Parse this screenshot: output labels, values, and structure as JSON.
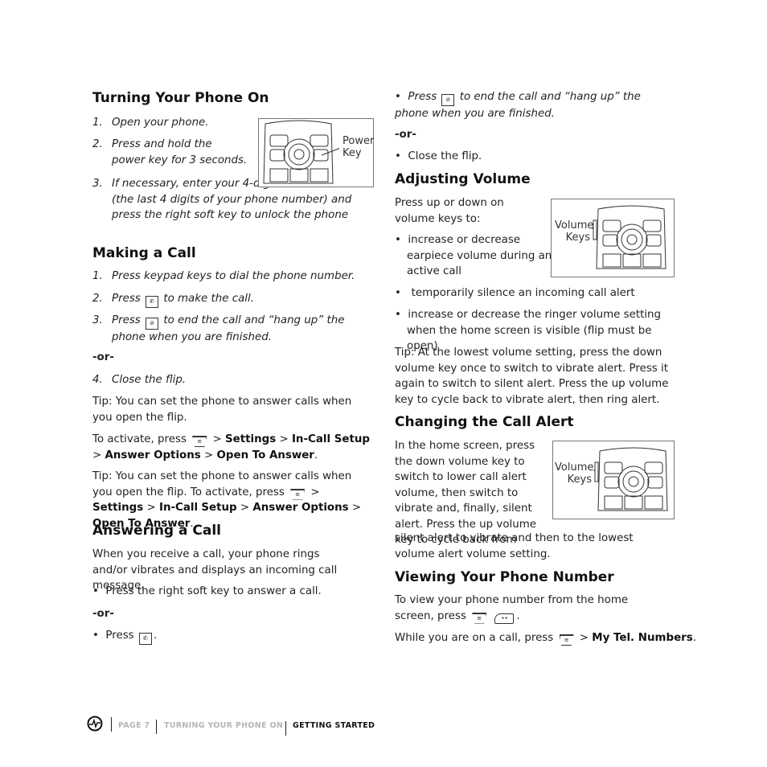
{
  "left": {
    "s1": {
      "title": "Turning Your Phone On",
      "steps": [
        "1.",
        "Open your phone.",
        "2.",
        "Press and hold the power key for 3 seconds.",
        "3.",
        "If necessary, enter your 4-digit unlock code (the last 4 digits of your phone number) and press the right soft key to unlock the phone"
      ],
      "fig_label": "Power Key"
    },
    "s2": {
      "title": "Making a Call",
      "s1n": "1.",
      "s1": "Press keypad keys to dial the phone number.",
      "s2n": "2.",
      "s2a": "Press",
      "s2b": "to make the call.",
      "s3n": "3.",
      "s3a": "Press",
      "s3b": "to end the call and “hang up” the phone when you are finished.",
      "or": "-or-",
      "s4n": "4.",
      "s4": "Close the flip.",
      "tip1": "Tip: You can set the phone to answer calls when you open the flip.",
      "act_a": "To activate, press",
      "gt": ">",
      "settings": "Settings",
      "incall": "In-Call Setup",
      "answer_opts": "Answer Options",
      "open_answer": "Open To Answer",
      "dot": ".",
      "tip2a": "Tip: You can set the phone to answer calls when you open the flip. To activate, press",
      "incall2a": "In-Call",
      "incall2b": "Setup"
    },
    "s3": {
      "title": "Answering a Call",
      "body": "When you receive a call, your phone rings and/or vibrates and displays an incoming call message.",
      "b1": "Press the right soft key to answer a call.",
      "or": "-or-",
      "b2": "Press",
      "b2end": "."
    }
  },
  "right": {
    "top": {
      "b1a": "Press",
      "b1b": "to end the call and “hang up” the phone when you are finished.",
      "or": "-or-",
      "b2": "Close the flip."
    },
    "vol": {
      "title": "Adjusting Volume",
      "intro": "Press up or down on volume keys to:",
      "b1": "increase or decrease earpiece volume during an active call",
      "b2": "temporarily silence an incoming call alert",
      "b3": "increase or decrease the ringer volume setting when the home screen is visible (flip must be open)",
      "tip": "Tip: At the lowest volume setting, press the down volume key once to switch to vibrate alert. Press it again to switch to silent alert. Press the up volume key to cycle back to vibrate alert, then ring alert.",
      "fig_label": "Volume Keys"
    },
    "alert": {
      "title": "Changing the Call Alert",
      "body1": "In the home screen, press the down volume key to switch to lower call alert volume, then switch to vibrate and, finally, silent alert. Press the up volume key to cycle back from",
      "body2": "silent alert to vibrate and then to the lowest volume alert volume setting.",
      "fig_label": "Volume Keys"
    },
    "num": {
      "title": "Viewing Your Phone Number",
      "body1": "To view your phone number from the home screen, press",
      "body1end": ".",
      "body2a": "While you are on a call, press",
      "gt": ">",
      "mytel": "My Tel. Numbers",
      "dot": "."
    }
  },
  "footer": {
    "page": "PAGE 7",
    "section": "TURNING YOUR PHONE ON",
    "chapter": "GETTING STARTED",
    "page_color": "#b5b5b5"
  }
}
